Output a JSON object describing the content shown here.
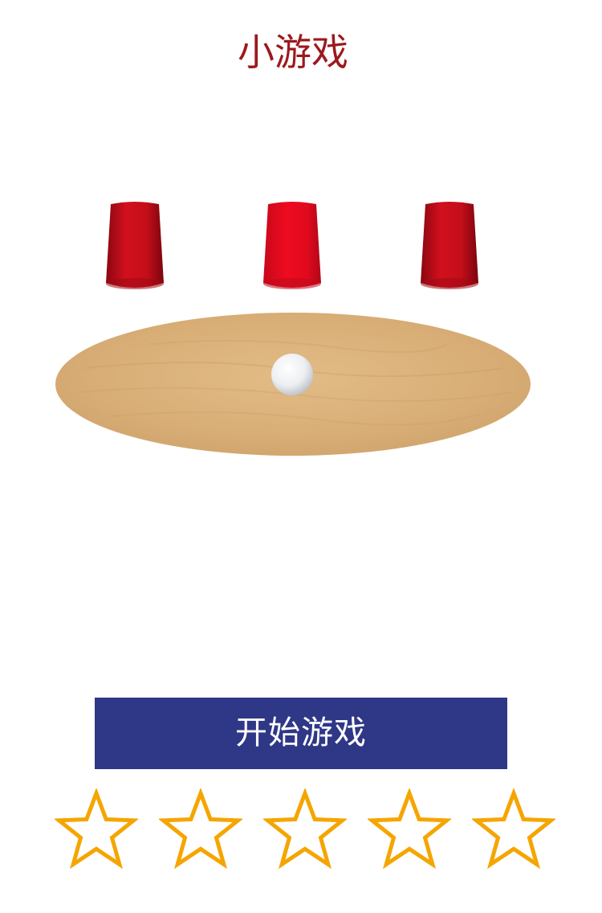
{
  "header": {
    "title": "小游戏"
  },
  "game": {
    "cups": [
      {
        "name": "cup-left",
        "color": "#d0101b"
      },
      {
        "name": "cup-middle",
        "color": "#e30a1e"
      },
      {
        "name": "cup-right",
        "color": "#d0101b"
      }
    ],
    "table_color": "#d9b07a",
    "ball_color": "#f0f2f4",
    "start_button_label": "开始游戏",
    "button_color": "#2f3787"
  },
  "rating": {
    "max": 5,
    "value": 0,
    "star_color": "#f5a500",
    "icon": "star-outline-icon"
  }
}
